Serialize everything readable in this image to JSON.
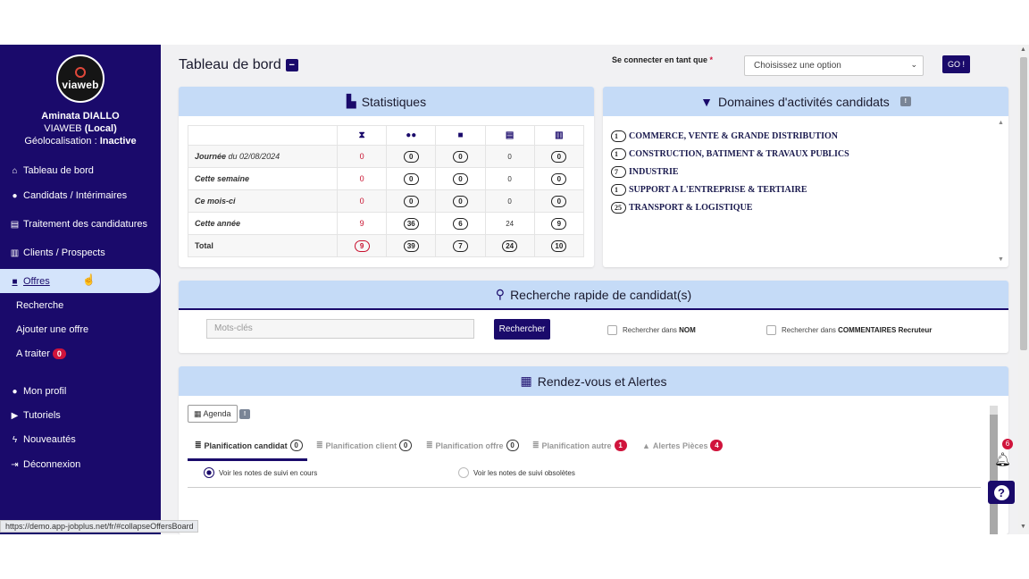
{
  "sidebar": {
    "avatar_logo": "viaweb",
    "user_name": "Aminata DIALLO",
    "company": "VIAWEB",
    "company_env": "(Local)",
    "geo_label": "Géolocalisation :",
    "geo_status": "Inactive",
    "items": [
      {
        "label": "Tableau de bord",
        "icon": "home-icon"
      },
      {
        "label": "Candidats / Intérimaires",
        "icon": "users-icon"
      },
      {
        "label": "Traitement des candidatures",
        "icon": "file-icon"
      },
      {
        "label": "Clients / Prospects",
        "icon": "building-icon"
      },
      {
        "label": "Offres",
        "icon": "briefcase-icon"
      },
      {
        "label": "Mon profil",
        "icon": "user-icon"
      },
      {
        "label": "Tutoriels",
        "icon": "video-icon"
      },
      {
        "label": "Nouveautés",
        "icon": "bolt-icon"
      },
      {
        "label": "Déconnexion",
        "icon": "logout-icon"
      }
    ],
    "sub_items": [
      {
        "label": "Recherche"
      },
      {
        "label": "Ajouter une offre"
      },
      {
        "label": "A traiter",
        "badge": "0"
      }
    ]
  },
  "header": {
    "title": "Tableau de bord",
    "connect_label": "Se connecter en tant que",
    "connect_required": "*",
    "select_value": "Choisissez une option",
    "go_label": "GO !"
  },
  "stats": {
    "title": "Statistiques",
    "rows": [
      {
        "label": "Journée",
        "sub": "du 02/08/2024",
        "v1": "0",
        "v2": "0",
        "v3": "0",
        "v4": "0",
        "v5": "0"
      },
      {
        "label": "Cette semaine",
        "sub": "",
        "v1": "0",
        "v2": "0",
        "v3": "0",
        "v4": "0",
        "v5": "0"
      },
      {
        "label": "Ce mois-ci",
        "sub": "",
        "v1": "0",
        "v2": "0",
        "v3": "0",
        "v4": "0",
        "v5": "0"
      },
      {
        "label": "Cette année",
        "sub": "",
        "v1": "9",
        "v2": "36",
        "v3": "6",
        "v4": "24",
        "v5": "9"
      },
      {
        "label": "Total",
        "sub": "",
        "v1": "9",
        "v2": "39",
        "v3": "7",
        "v4": "24",
        "v5": "10"
      }
    ]
  },
  "domains": {
    "title": "Domaines d'activités candidats",
    "items": [
      {
        "count": "1",
        "label": "COMMERCE, VENTE & GRANDE DISTRIBUTION"
      },
      {
        "count": "1",
        "label": "CONSTRUCTION, BATIMENT & TRAVAUX PUBLICS"
      },
      {
        "count": "7",
        "label": "INDUSTRIE"
      },
      {
        "count": "1",
        "label": "SUPPORT A L'ENTREPRISE & TERTIAIRE"
      },
      {
        "count": "25",
        "label": "TRANSPORT & LOGISTIQUE"
      }
    ]
  },
  "search": {
    "title": "Recherche rapide de candidat(s)",
    "placeholder": "Mots-clés",
    "button": "Rechercher",
    "check1_prefix": "Rechercher dans",
    "check1_bold": "NOM",
    "check2_prefix": "Rechercher dans",
    "check2_bold": "COMMENTAIRES Recruteur"
  },
  "rdv": {
    "title": "Rendez-vous et Alertes",
    "agenda_label": "Agenda",
    "tabs": [
      {
        "label": "Planification candidat",
        "count": "0"
      },
      {
        "label": "Planification client",
        "count": "0"
      },
      {
        "label": "Planification offre",
        "count": "0"
      },
      {
        "label": "Planification autre",
        "count": "1"
      },
      {
        "label": "Alertes Pièces",
        "count": "4"
      }
    ],
    "radio1": "Voir les notes de suivi en cours",
    "radio2": "Voir les notes de suivi obsolètes"
  },
  "status_url": "https://demo.app-jobplus.net/fr/#collapseOffersBoard",
  "notifications": {
    "count": "6"
  },
  "colors": {
    "sidebar": "#1a0a6b",
    "card_header": "#c5dbf7",
    "badge": "#d0143c"
  }
}
